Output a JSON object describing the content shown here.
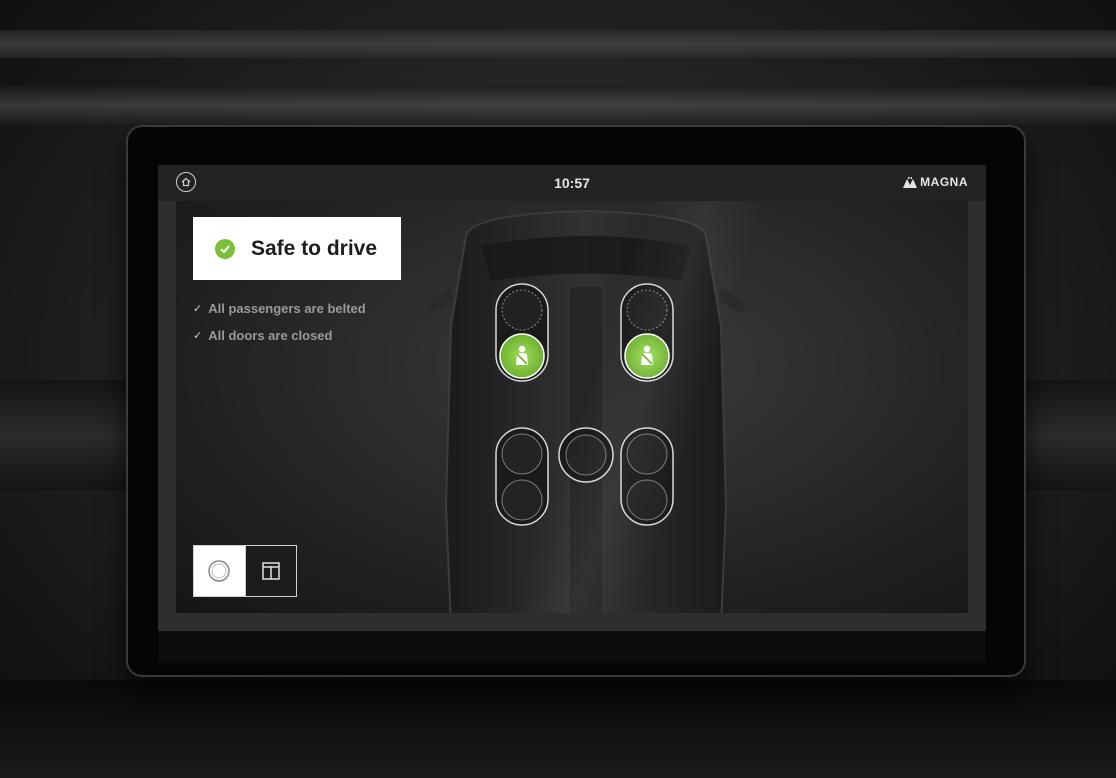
{
  "header": {
    "time": "10:57",
    "brand": "MAGNA"
  },
  "status": {
    "title": "Safe to drive",
    "checks": [
      "All passengers are belted",
      "All doors are closed"
    ]
  },
  "seats": [
    {
      "id": "front-left",
      "occupied": true,
      "belted": true
    },
    {
      "id": "front-right",
      "occupied": true,
      "belted": true
    },
    {
      "id": "rear-left",
      "occupied": false,
      "belted": false
    },
    {
      "id": "rear-center",
      "occupied": false,
      "belted": false
    },
    {
      "id": "rear-right",
      "occupied": false,
      "belted": false
    }
  ],
  "view_toggle": {
    "options": [
      "seat-view",
      "grid-view"
    ],
    "selected": "seat-view"
  },
  "colors": {
    "ok_green": "#7bbf3a",
    "screen_bg": "#2e2e30",
    "text_light": "#e6e6e6"
  },
  "icons": [
    "home-icon",
    "magna-logo-icon",
    "check-circle-icon",
    "check-icon",
    "seatbelt-person-icon",
    "circle-view-icon",
    "grid-view-icon"
  ]
}
